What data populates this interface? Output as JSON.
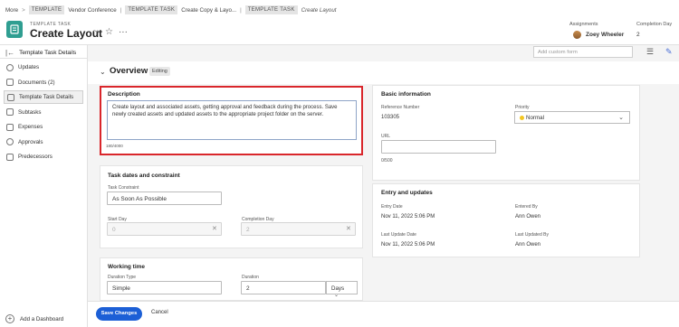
{
  "breadcrumb": {
    "more": "More",
    "chev": ">",
    "tag1": "TEMPLATE",
    "item1": "Vendor Conference",
    "sep": "|",
    "tag2": "TEMPLATE TASK",
    "item2": "Create Copy & Layo...",
    "tag3": "TEMPLATE TASK",
    "current": "Create Layout"
  },
  "header": {
    "type_label": "TEMPLATE TASK",
    "title": "Create Layout",
    "assignments_label": "Assignments",
    "assignee": "Zoey Wheeler",
    "completion_label": "Completion Day",
    "completion_value": "2"
  },
  "sidebar": {
    "header": "Template Task Details",
    "items": [
      {
        "label": "Updates",
        "icon": "chat-icon"
      },
      {
        "label": "Documents (2)",
        "icon": "document-icon"
      },
      {
        "label": "Template Task Details",
        "icon": "details-icon"
      },
      {
        "label": "Subtasks",
        "icon": "subtasks-icon"
      },
      {
        "label": "Expenses",
        "icon": "expenses-icon"
      },
      {
        "label": "Approvals",
        "icon": "approvals-icon"
      },
      {
        "label": "Predecessors",
        "icon": "predecessors-icon"
      }
    ],
    "add_dashboard": "Add a Dashboard"
  },
  "overview": {
    "title": "Overview",
    "badge": "Editing",
    "custom_form_placeholder": "Add custom form"
  },
  "description": {
    "title": "Description",
    "text": "Create layout and associated assets, getting approval and feedback during the process. Save newly created assets and updated assets to the appropriate project folder on the server.",
    "counter": "180/4000"
  },
  "basic": {
    "title": "Basic information",
    "ref_label": "Reference Number",
    "ref_value": "103305",
    "priority_label": "Priority",
    "priority_value": "Normal",
    "url_label": "URL",
    "url_counter": "0/500"
  },
  "task_dates": {
    "title": "Task dates and constraint",
    "constraint_label": "Task Constraint",
    "constraint_value": "As Soon As Possible",
    "start_label": "Start Day",
    "start_value": "0",
    "completion_label": "Completion Day",
    "completion_value": "2"
  },
  "entry": {
    "title": "Entry and updates",
    "entry_date_label": "Entry Date",
    "entry_date_value": "Nov 11, 2022 5:06 PM",
    "entered_by_label": "Entered By",
    "entered_by_value": "Ann Owen",
    "last_update_label": "Last Update Date",
    "last_update_value": "Nov 11, 2022 5:06 PM",
    "last_updated_by_label": "Last Updated By",
    "last_updated_by_value": "Ann Owen"
  },
  "working": {
    "title": "Working time",
    "duration_type_label": "Duration Type",
    "duration_type_value": "Simple",
    "duration_label": "Duration",
    "duration_value": "2",
    "duration_unit": "Days"
  },
  "footer": {
    "save": "Save Changes",
    "cancel": "Cancel"
  },
  "colors": {
    "accent": "#1c5fd6",
    "highlight": "#d9262b",
    "task_icon": "#2f9e91"
  }
}
